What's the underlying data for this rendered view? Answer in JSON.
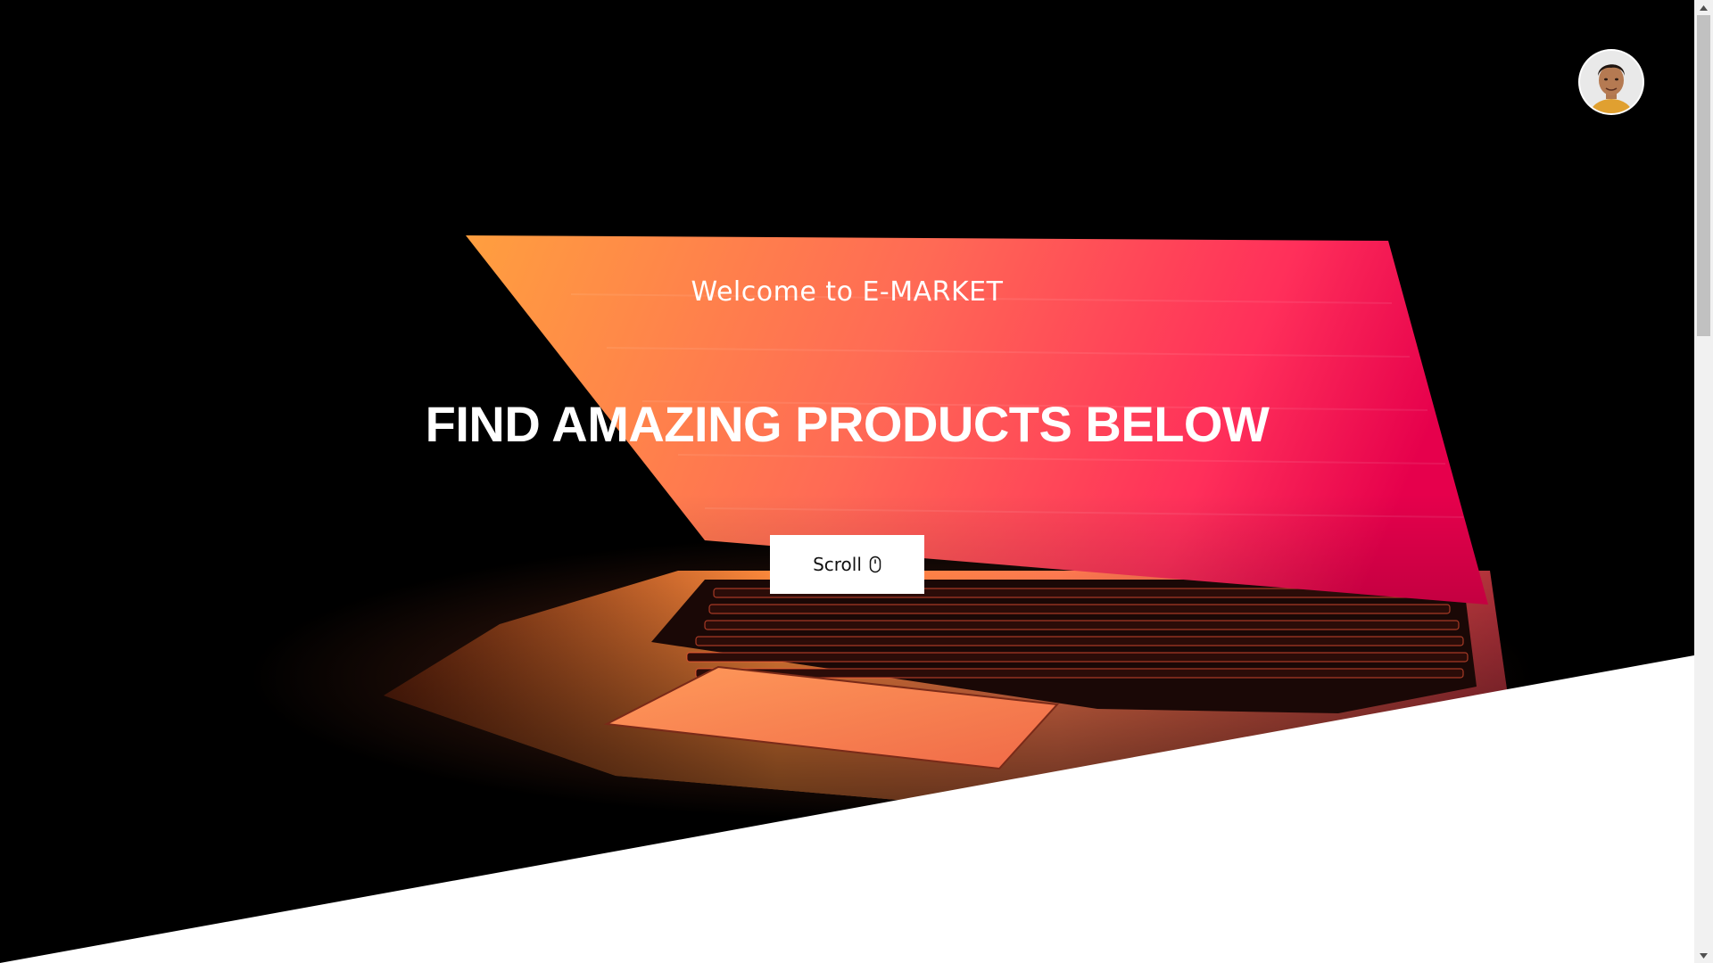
{
  "hero": {
    "welcome_text": "Welcome to E-MARKET",
    "headline": "FIND AMAZING PRODUCTS BELOW",
    "scroll_button_label": "Scroll",
    "scroll_button_icon": "mouse-icon"
  },
  "profile": {
    "avatar_icon": "user-avatar"
  },
  "colors": {
    "screen_gradient_start": "#ff9a3c",
    "screen_gradient_mid": "#ff4e50",
    "screen_gradient_end": "#e8004e",
    "background": "#000000",
    "diagonal_section": "#ffffff"
  }
}
